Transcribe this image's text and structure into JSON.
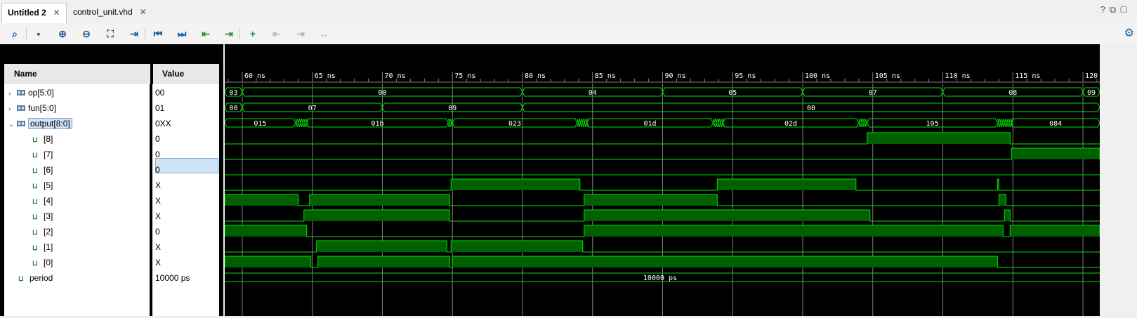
{
  "tabs": [
    {
      "label": "Untitled 2",
      "active": true
    },
    {
      "label": "control_unit.vhd",
      "active": false
    }
  ],
  "window_buttons": {
    "help": "?",
    "restore": "⧉",
    "maximize": "▢"
  },
  "toolbar": {
    "buttons": [
      {
        "name": "search-icon",
        "glyph": "⌕"
      },
      {
        "name": "save-icon",
        "glyph": "▪"
      },
      {
        "name": "zoom-in-icon",
        "glyph": "⊕"
      },
      {
        "name": "zoom-out-icon",
        "glyph": "⊖"
      },
      {
        "name": "zoom-fit-icon",
        "glyph": "⛶"
      },
      {
        "name": "go-to-cursor-icon",
        "glyph": "⇥"
      },
      {
        "name": "go-to-time-zero-icon",
        "glyph": "⏮"
      },
      {
        "name": "go-to-last-time-icon",
        "glyph": "⏭"
      },
      {
        "name": "previous-transition-icon",
        "glyph": "⇤"
      },
      {
        "name": "next-transition-icon",
        "glyph": "⇥"
      },
      {
        "name": "add-marker-icon",
        "glyph": "+"
      },
      {
        "name": "previous-marker-icon",
        "glyph": "⇤"
      },
      {
        "name": "next-marker-icon",
        "glyph": "⇥"
      },
      {
        "name": "swap-cursors-icon",
        "glyph": "↔"
      }
    ]
  },
  "columns": {
    "name": "Name",
    "value": "Value"
  },
  "signals": [
    {
      "name": "op[5:0]",
      "value": "00",
      "kind": "bus",
      "expand": "›"
    },
    {
      "name": "fun[5:0]",
      "value": "01",
      "kind": "bus",
      "expand": "›"
    },
    {
      "name": "output[8:0]",
      "value": "0XX",
      "kind": "bus",
      "expand": "⌄",
      "selected": true
    },
    {
      "name": "[8]",
      "value": "0",
      "kind": "bit"
    },
    {
      "name": "[7]",
      "value": "0",
      "kind": "bit"
    },
    {
      "name": "[6]",
      "value": "0",
      "kind": "bit"
    },
    {
      "name": "[5]",
      "value": "X",
      "kind": "bit"
    },
    {
      "name": "[4]",
      "value": "X",
      "kind": "bit"
    },
    {
      "name": "[3]",
      "value": "X",
      "kind": "bit"
    },
    {
      "name": "[2]",
      "value": "0",
      "kind": "bit"
    },
    {
      "name": "[1]",
      "value": "X",
      "kind": "bit"
    },
    {
      "name": "[0]",
      "value": "X",
      "kind": "bit"
    },
    {
      "name": "period",
      "value": "10000 ps",
      "kind": "bit"
    }
  ],
  "timeline": {
    "ticks": [
      "60 ns",
      "65 ns",
      "70 ns",
      "75 ns",
      "80 ns",
      "85 ns",
      "90 ns",
      "95 ns",
      "100 ns",
      "105 ns",
      "110 ns",
      "115 ns",
      "120 ns"
    ],
    "start_ns": 58.75,
    "end_ns": 121.2,
    "cursor_ns": 115
  },
  "waves": {
    "op": [
      {
        "from": 58.75,
        "to": 60,
        "label": "03"
      },
      {
        "from": 60,
        "to": 80,
        "label": "00"
      },
      {
        "from": 80,
        "to": 90,
        "label": "04"
      },
      {
        "from": 90,
        "to": 100,
        "label": "05"
      },
      {
        "from": 100,
        "to": 110,
        "label": "07"
      },
      {
        "from": 110,
        "to": 120,
        "label": "08"
      },
      {
        "from": 120,
        "to": 121.2,
        "label": "09"
      }
    ],
    "fun": [
      {
        "from": 58.75,
        "to": 60,
        "label": "00"
      },
      {
        "from": 60,
        "to": 70,
        "label": "07"
      },
      {
        "from": 70,
        "to": 80,
        "label": "09"
      },
      {
        "from": 80,
        "to": 121.2,
        "label": "00"
      }
    ],
    "output": [
      {
        "from": 58.75,
        "to": 63.8,
        "label": "015"
      },
      {
        "from": 64.6,
        "to": 74.7,
        "label": "01b"
      },
      {
        "from": 75.0,
        "to": 83.9,
        "label": "023"
      },
      {
        "from": 84.6,
        "to": 93.6,
        "label": "01d"
      },
      {
        "from": 94.3,
        "to": 104.0,
        "label": "02d"
      },
      {
        "from": 104.6,
        "to": 113.9,
        "label": "105"
      },
      {
        "from": 114.9,
        "to": 121.2,
        "label": "084"
      }
    ],
    "bits": {
      "8": [
        [
          104.6,
          114.8
        ]
      ],
      "7": [
        [
          114.9,
          121.2
        ]
      ],
      "6": [],
      "5": [
        [
          74.9,
          84.1
        ],
        [
          93.9,
          103.8
        ],
        [
          113.9,
          114.0
        ]
      ],
      "4": [
        [
          58.75,
          64.0
        ],
        [
          64.8,
          74.8
        ],
        [
          84.4,
          93.9
        ],
        [
          114.0,
          114.5
        ]
      ],
      "3": [
        [
          64.4,
          74.8
        ],
        [
          84.4,
          104.8
        ],
        [
          114.4,
          114.8
        ]
      ],
      "2": [
        [
          58.75,
          64.6
        ],
        [
          84.4,
          114.3
        ],
        [
          114.8,
          121.2
        ]
      ],
      "1": [
        [
          65.3,
          74.6
        ],
        [
          74.9,
          84.3
        ]
      ],
      "0": [
        [
          58.75,
          64.9
        ],
        [
          65.4,
          74.8
        ],
        [
          75.0,
          113.9
        ]
      ]
    },
    "period": "10000 ps"
  },
  "colors": {
    "wave": "#00e000",
    "fill": "#006000",
    "grid": "#808080",
    "text": "#ffffff",
    "selected": "#d0e4f7"
  }
}
